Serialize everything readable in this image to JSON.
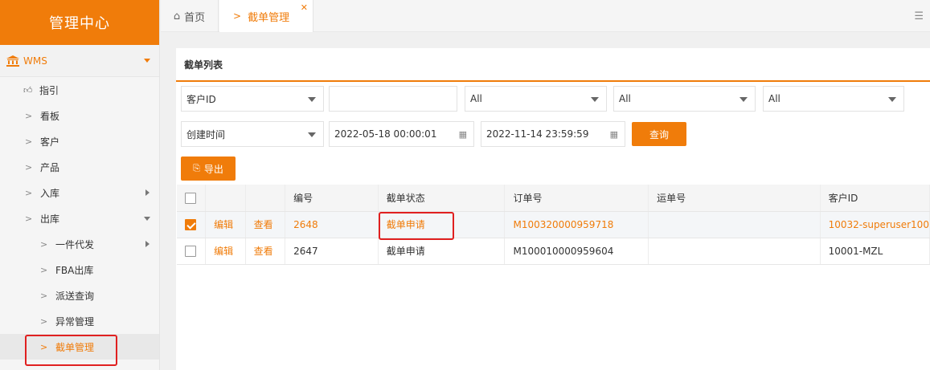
{
  "sidebar": {
    "brand": "管理中心",
    "group": "WMS",
    "items": [
      {
        "label": "指引"
      },
      {
        "label": "看板"
      },
      {
        "label": "客户"
      },
      {
        "label": "产品"
      },
      {
        "label": "入库"
      },
      {
        "label": "出库"
      }
    ],
    "sub_items": [
      {
        "label": "一件代发"
      },
      {
        "label": "FBA出库"
      },
      {
        "label": "派送查询"
      },
      {
        "label": "异常管理"
      },
      {
        "label": "截单管理"
      }
    ]
  },
  "tabs": {
    "home": "首页",
    "current": "截单管理"
  },
  "panel": {
    "title": "截单列表"
  },
  "filters": {
    "customer_select": "客户ID",
    "customer_input": "",
    "select1": "All",
    "select2": "All",
    "select3": "All",
    "time_select": "创建时间",
    "start_time": "2022-05-18 00:00:01",
    "end_time": "2022-11-14 23:59:59",
    "query_button": "查询",
    "export_button": "导出"
  },
  "table": {
    "headers": [
      "",
      "",
      "",
      "编号",
      "截单状态",
      "订单号",
      "运单号",
      "客户ID"
    ],
    "rows": [
      {
        "checked": true,
        "edit": "编辑",
        "view": "查看",
        "id": "2648",
        "status": "截单申请",
        "order": "M100320000959718",
        "waybill": "",
        "customer": "10032-superuser100"
      },
      {
        "checked": false,
        "edit": "编辑",
        "view": "查看",
        "id": "2647",
        "status": "截单申请",
        "order": "M100010000959604",
        "waybill": "",
        "customer": "10001-MZL"
      }
    ]
  },
  "colors": {
    "accent": "#f07c0a",
    "highlight_box": "#e02020"
  }
}
